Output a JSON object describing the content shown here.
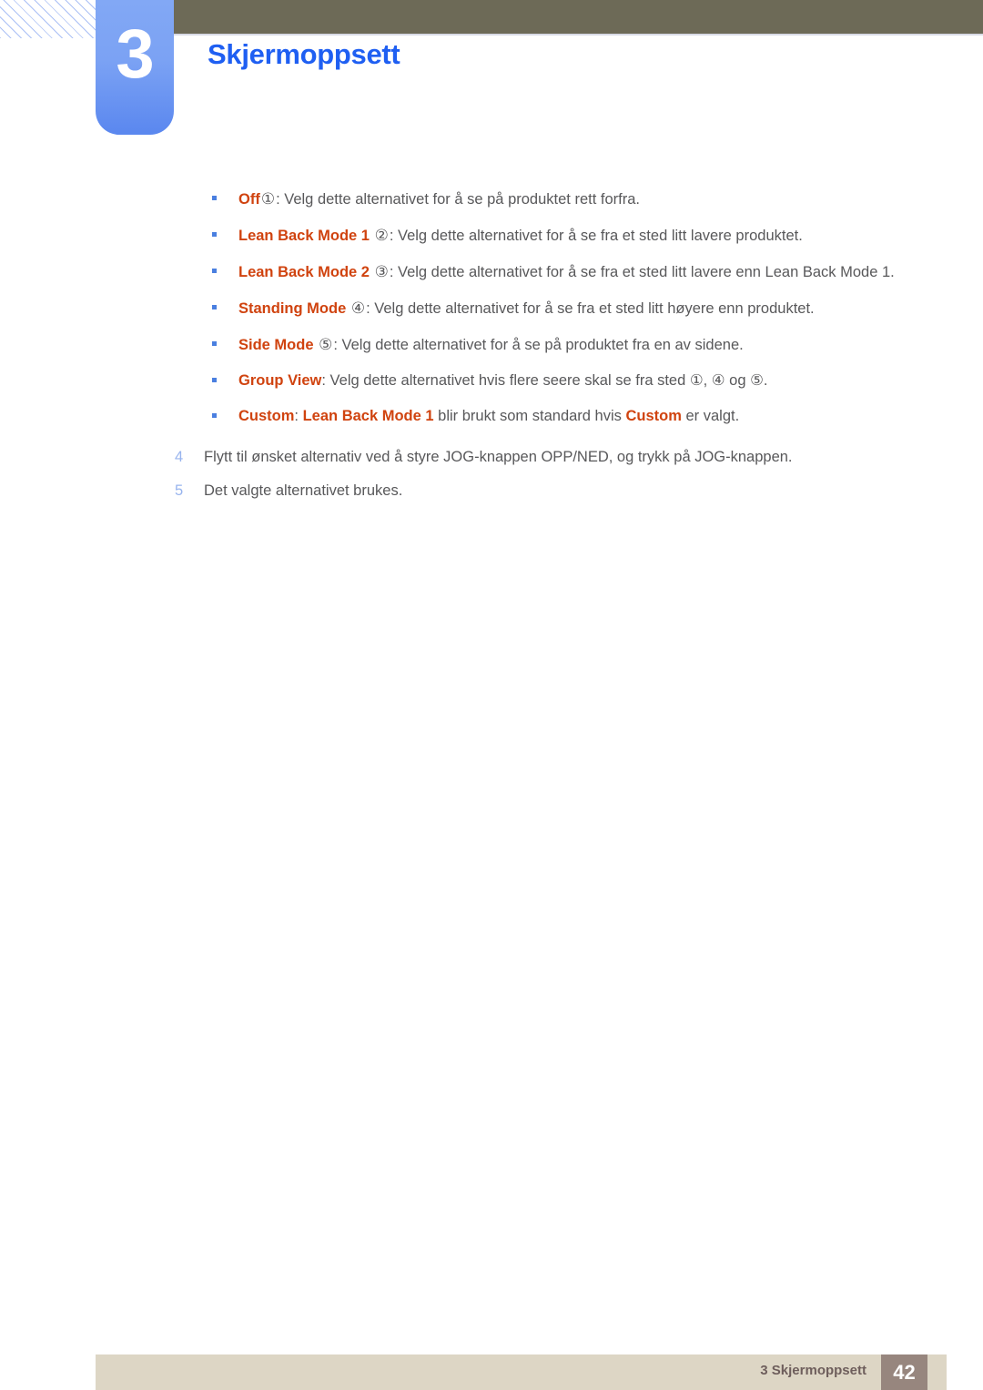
{
  "header": {
    "chapter_number": "3",
    "chapter_title": "Skjermoppsett",
    "accent_blue": "#1f5ff2",
    "tab_blue": "#7ba2f4",
    "bar_olive": "#6d6a57"
  },
  "content": {
    "bullets": [
      {
        "term": "Off",
        "marker": "①",
        "text": ": Velg dette alternativet for å se på produktet rett forfra."
      },
      {
        "term": "Lean Back Mode 1",
        "marker": "②",
        "text": ": Velg dette alternativet for å se fra et sted litt lavere produktet."
      },
      {
        "term": "Lean Back Mode 2",
        "marker": "③",
        "text": ": Velg dette alternativet for å se fra et sted litt lavere enn Lean Back Mode 1."
      },
      {
        "term": "Standing Mode",
        "marker": "④",
        "text": ": Velg dette alternativet for å se fra et sted litt høyere enn produktet."
      },
      {
        "term": "Side Mode",
        "marker": "⑤",
        "text": ": Velg dette alternativet for å se på produktet fra en av sidene."
      },
      {
        "term": "Group View",
        "marker": "",
        "text": ": Velg dette alternativet hvis flere seere skal se fra sted ①, ④ og ⑤."
      },
      {
        "term": "Custom",
        "marker": "",
        "text": ": Lean Back Mode 1 blir brukt som standard hvis Custom er valgt.",
        "term2": "Lean Back Mode 1",
        "term3": "Custom",
        "part_a": ": ",
        "part_b": " blir brukt som standard hvis ",
        "part_c": " er valgt."
      }
    ],
    "steps": [
      {
        "number": "4",
        "text": "Flytt til ønsket alternativ ved å styre JOG-knappen OPP/NED, og trykk på JOG-knappen."
      },
      {
        "number": "5",
        "text": "Det valgte alternativet brukes."
      }
    ],
    "term_color": "#d0430f",
    "body_color": "#58585a",
    "step_number_color": "#98b4ee"
  },
  "footer": {
    "label": "3 Skjermoppsett",
    "page_number": "42",
    "bar_color": "#ddd6c5",
    "page_box_color": "#97867e"
  }
}
